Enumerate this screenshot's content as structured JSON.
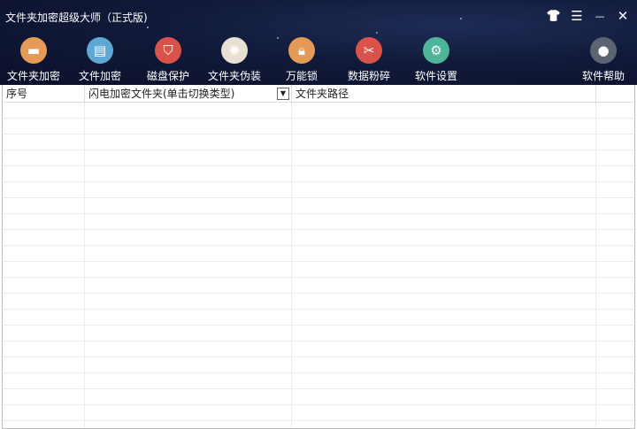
{
  "window": {
    "title": "文件夹加密超级大师（正式版)"
  },
  "controls": [
    {
      "name": "skin-icon",
      "glyph": "👕"
    },
    {
      "name": "menu-icon",
      "glyph": "☰"
    },
    {
      "name": "minimize-icon",
      "glyph": "—"
    },
    {
      "name": "close-icon",
      "glyph": "✕"
    }
  ],
  "toolbar": [
    {
      "label": "文件夹加密",
      "icon": "folder-icon",
      "color": "#e69a57"
    },
    {
      "label": "文件加密",
      "icon": "clipboard-icon",
      "color": "#5fa8d6"
    },
    {
      "label": "磁盘保护",
      "icon": "shield-icon",
      "color": "#d9534a"
    },
    {
      "label": "文件夹伪装",
      "icon": "palette-icon",
      "color": "#e8e0d2"
    },
    {
      "label": "万能锁",
      "icon": "lock-icon",
      "color": "#e69a57"
    },
    {
      "label": "数据粉碎",
      "icon": "scissors-icon",
      "color": "#d9534a"
    },
    {
      "label": "软件设置",
      "icon": "gear-icon",
      "color": "#4fb59a"
    },
    {
      "label": "软件帮助",
      "icon": "user-icon",
      "color": "#5c6472"
    }
  ],
  "table": {
    "columns": [
      "序号",
      "闪电加密文件夹(单击切换类型)",
      "文件夹路径",
      ""
    ],
    "dropdown_glyph": "▼"
  }
}
